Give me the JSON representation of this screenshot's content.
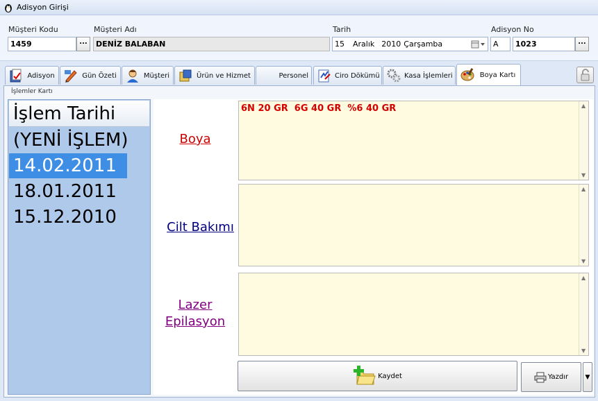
{
  "window": {
    "title": "Adisyon Girişi"
  },
  "header": {
    "musteri_kodu": {
      "label": "Müşteri Kodu",
      "value": "1459",
      "button": "..."
    },
    "musteri_adi": {
      "label": "Müşteri Adı",
      "value": "DENİZ BALABAN"
    },
    "tarih": {
      "label": "Tarih",
      "day": "15",
      "month": "Aralık",
      "year": "2010",
      "weekday": "Çarşamba"
    },
    "adisyon_no": {
      "label": "Adisyon No",
      "prefix": "A",
      "value": "1023",
      "button": "..."
    }
  },
  "tabs": [
    {
      "label": "Adisyon",
      "icon": "adisyon-icon"
    },
    {
      "label": "Gün Özeti",
      "icon": "pencil-icon"
    },
    {
      "label": "Müşteri",
      "icon": "customer-icon"
    },
    {
      "label": "Ürün ve Hizmet",
      "icon": "product-icon"
    },
    {
      "label": "Personel",
      "icon": "staff-icon"
    },
    {
      "label": "Ciro Dökümü",
      "icon": "report-icon"
    },
    {
      "label": "Kasa İşlemleri",
      "icon": "gears-icon"
    },
    {
      "label": "Boya Kartı",
      "icon": "palette-icon",
      "active": true
    }
  ],
  "panel": {
    "caption": "İşlemler Kartı",
    "list_header": "İşlem Tarihi",
    "dates": [
      "(YENİ İŞLEM)",
      "14.02.2011",
      "18.01.2011",
      "15.12.2010"
    ],
    "selected_index": 1
  },
  "sections": {
    "boya": {
      "label": "Boya",
      "text": "6N 20 GR  6G 40 GR  %6 40 GR",
      "color": "#cc0000"
    },
    "cilt": {
      "label": "Cilt Bakımı",
      "text": "",
      "color": "#000080"
    },
    "lazer": {
      "label_line1": "Lazer",
      "label_line2": "Epilasyon",
      "text": "",
      "color": "#800080"
    }
  },
  "buttons": {
    "kaydet": "Kaydet",
    "yazdir": "Yazdır"
  },
  "colors": {
    "accent_selection": "#3f8ee6",
    "memo_bg": "#fefbe0",
    "list_bg": "#aec9ea"
  }
}
